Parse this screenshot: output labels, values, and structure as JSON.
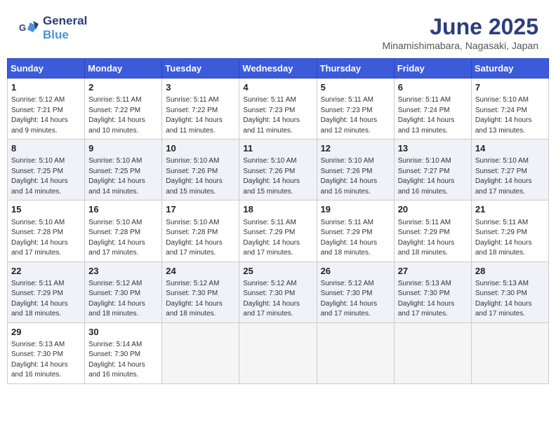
{
  "header": {
    "logo_general": "General",
    "logo_blue": "Blue",
    "title": "June 2025",
    "subtitle": "Minamishimabara, Nagasaki, Japan"
  },
  "weekdays": [
    "Sunday",
    "Monday",
    "Tuesday",
    "Wednesday",
    "Thursday",
    "Friday",
    "Saturday"
  ],
  "weeks": [
    {
      "shaded": false,
      "days": [
        {
          "num": "1",
          "rise": "5:12 AM",
          "set": "7:21 PM",
          "daylight": "14 hours and 9 minutes."
        },
        {
          "num": "2",
          "rise": "5:11 AM",
          "set": "7:22 PM",
          "daylight": "14 hours and 10 minutes."
        },
        {
          "num": "3",
          "rise": "5:11 AM",
          "set": "7:22 PM",
          "daylight": "14 hours and 11 minutes."
        },
        {
          "num": "4",
          "rise": "5:11 AM",
          "set": "7:23 PM",
          "daylight": "14 hours and 11 minutes."
        },
        {
          "num": "5",
          "rise": "5:11 AM",
          "set": "7:23 PM",
          "daylight": "14 hours and 12 minutes."
        },
        {
          "num": "6",
          "rise": "5:11 AM",
          "set": "7:24 PM",
          "daylight": "14 hours and 13 minutes."
        },
        {
          "num": "7",
          "rise": "5:10 AM",
          "set": "7:24 PM",
          "daylight": "14 hours and 13 minutes."
        }
      ]
    },
    {
      "shaded": true,
      "days": [
        {
          "num": "8",
          "rise": "5:10 AM",
          "set": "7:25 PM",
          "daylight": "14 hours and 14 minutes."
        },
        {
          "num": "9",
          "rise": "5:10 AM",
          "set": "7:25 PM",
          "daylight": "14 hours and 14 minutes."
        },
        {
          "num": "10",
          "rise": "5:10 AM",
          "set": "7:26 PM",
          "daylight": "14 hours and 15 minutes."
        },
        {
          "num": "11",
          "rise": "5:10 AM",
          "set": "7:26 PM",
          "daylight": "14 hours and 15 minutes."
        },
        {
          "num": "12",
          "rise": "5:10 AM",
          "set": "7:26 PM",
          "daylight": "14 hours and 16 minutes."
        },
        {
          "num": "13",
          "rise": "5:10 AM",
          "set": "7:27 PM",
          "daylight": "14 hours and 16 minutes."
        },
        {
          "num": "14",
          "rise": "5:10 AM",
          "set": "7:27 PM",
          "daylight": "14 hours and 17 minutes."
        }
      ]
    },
    {
      "shaded": false,
      "days": [
        {
          "num": "15",
          "rise": "5:10 AM",
          "set": "7:28 PM",
          "daylight": "14 hours and 17 minutes."
        },
        {
          "num": "16",
          "rise": "5:10 AM",
          "set": "7:28 PM",
          "daylight": "14 hours and 17 minutes."
        },
        {
          "num": "17",
          "rise": "5:10 AM",
          "set": "7:28 PM",
          "daylight": "14 hours and 17 minutes."
        },
        {
          "num": "18",
          "rise": "5:11 AM",
          "set": "7:29 PM",
          "daylight": "14 hours and 17 minutes."
        },
        {
          "num": "19",
          "rise": "5:11 AM",
          "set": "7:29 PM",
          "daylight": "14 hours and 18 minutes."
        },
        {
          "num": "20",
          "rise": "5:11 AM",
          "set": "7:29 PM",
          "daylight": "14 hours and 18 minutes."
        },
        {
          "num": "21",
          "rise": "5:11 AM",
          "set": "7:29 PM",
          "daylight": "14 hours and 18 minutes."
        }
      ]
    },
    {
      "shaded": true,
      "days": [
        {
          "num": "22",
          "rise": "5:11 AM",
          "set": "7:29 PM",
          "daylight": "14 hours and 18 minutes."
        },
        {
          "num": "23",
          "rise": "5:12 AM",
          "set": "7:30 PM",
          "daylight": "14 hours and 18 minutes."
        },
        {
          "num": "24",
          "rise": "5:12 AM",
          "set": "7:30 PM",
          "daylight": "14 hours and 18 minutes."
        },
        {
          "num": "25",
          "rise": "5:12 AM",
          "set": "7:30 PM",
          "daylight": "14 hours and 17 minutes."
        },
        {
          "num": "26",
          "rise": "5:12 AM",
          "set": "7:30 PM",
          "daylight": "14 hours and 17 minutes."
        },
        {
          "num": "27",
          "rise": "5:13 AM",
          "set": "7:30 PM",
          "daylight": "14 hours and 17 minutes."
        },
        {
          "num": "28",
          "rise": "5:13 AM",
          "set": "7:30 PM",
          "daylight": "14 hours and 17 minutes."
        }
      ]
    },
    {
      "shaded": false,
      "days": [
        {
          "num": "29",
          "rise": "5:13 AM",
          "set": "7:30 PM",
          "daylight": "14 hours and 16 minutes."
        },
        {
          "num": "30",
          "rise": "5:14 AM",
          "set": "7:30 PM",
          "daylight": "14 hours and 16 minutes."
        },
        null,
        null,
        null,
        null,
        null
      ]
    }
  ],
  "labels": {
    "sunrise": "Sunrise:",
    "sunset": "Sunset:",
    "daylight": "Daylight:"
  }
}
